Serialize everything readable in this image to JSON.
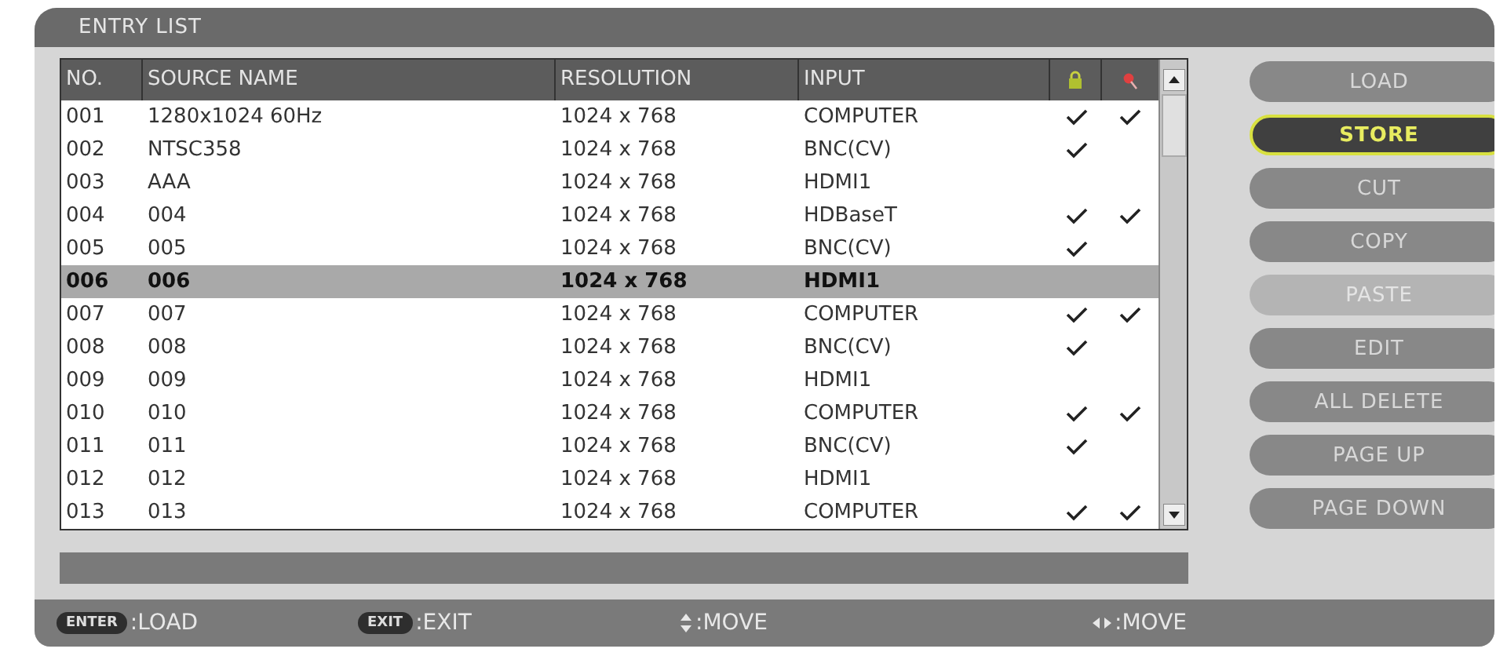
{
  "title": "ENTRY LIST",
  "columns": [
    "NO.",
    "SOURCE NAME",
    "RESOLUTION",
    "INPUT"
  ],
  "rows": [
    {
      "no": "001",
      "name": "1280x1024 60Hz",
      "resolution": "1024 x 768",
      "input": "COMPUTER",
      "lock": true,
      "skip": true,
      "selected": false
    },
    {
      "no": "002",
      "name": "NTSC358",
      "resolution": "1024 x 768",
      "input": "BNC(CV)",
      "lock": true,
      "skip": false,
      "selected": false
    },
    {
      "no": "003",
      "name": "AAA",
      "resolution": "1024 x 768",
      "input": "HDMI1",
      "lock": false,
      "skip": false,
      "selected": false
    },
    {
      "no": "004",
      "name": "004",
      "resolution": "1024 x 768",
      "input": "HDBaseT",
      "lock": true,
      "skip": true,
      "selected": false
    },
    {
      "no": "005",
      "name": "005",
      "resolution": "1024 x 768",
      "input": "BNC(CV)",
      "lock": true,
      "skip": false,
      "selected": false
    },
    {
      "no": "006",
      "name": "006",
      "resolution": "1024 x 768",
      "input": "HDMI1",
      "lock": false,
      "skip": false,
      "selected": true
    },
    {
      "no": "007",
      "name": "007",
      "resolution": "1024 x 768",
      "input": "COMPUTER",
      "lock": true,
      "skip": true,
      "selected": false
    },
    {
      "no": "008",
      "name": "008",
      "resolution": "1024 x 768",
      "input": "BNC(CV)",
      "lock": true,
      "skip": false,
      "selected": false
    },
    {
      "no": "009",
      "name": "009",
      "resolution": "1024 x 768",
      "input": "HDMI1",
      "lock": false,
      "skip": false,
      "selected": false
    },
    {
      "no": "010",
      "name": "010",
      "resolution": "1024 x 768",
      "input": "COMPUTER",
      "lock": true,
      "skip": true,
      "selected": false
    },
    {
      "no": "011",
      "name": "011",
      "resolution": "1024 x 768",
      "input": "BNC(CV)",
      "lock": true,
      "skip": false,
      "selected": false
    },
    {
      "no": "012",
      "name": "012",
      "resolution": "1024 x 768",
      "input": "HDMI1",
      "lock": false,
      "skip": false,
      "selected": false
    },
    {
      "no": "013",
      "name": "013",
      "resolution": "1024 x 768",
      "input": "COMPUTER",
      "lock": true,
      "skip": true,
      "selected": false
    }
  ],
  "buttons": [
    {
      "label": "LOAD",
      "focused": false,
      "disabled": false
    },
    {
      "label": "STORE",
      "focused": true,
      "disabled": false
    },
    {
      "label": "CUT",
      "focused": false,
      "disabled": false
    },
    {
      "label": "COPY",
      "focused": false,
      "disabled": false
    },
    {
      "label": "PASTE",
      "focused": false,
      "disabled": true
    },
    {
      "label": "EDIT",
      "focused": false,
      "disabled": false
    },
    {
      "label": "ALL DELETE",
      "focused": false,
      "disabled": false
    },
    {
      "label": "PAGE UP",
      "focused": false,
      "disabled": false
    },
    {
      "label": "PAGE DOWN",
      "focused": false,
      "disabled": false
    }
  ],
  "footer": [
    {
      "kind": "key",
      "key": "ENTER",
      "label": ":LOAD"
    },
    {
      "kind": "key",
      "key": "EXIT",
      "label": ":EXIT"
    },
    {
      "kind": "updown",
      "label": ":MOVE"
    },
    {
      "kind": "leftright",
      "label": ":MOVE"
    }
  ]
}
